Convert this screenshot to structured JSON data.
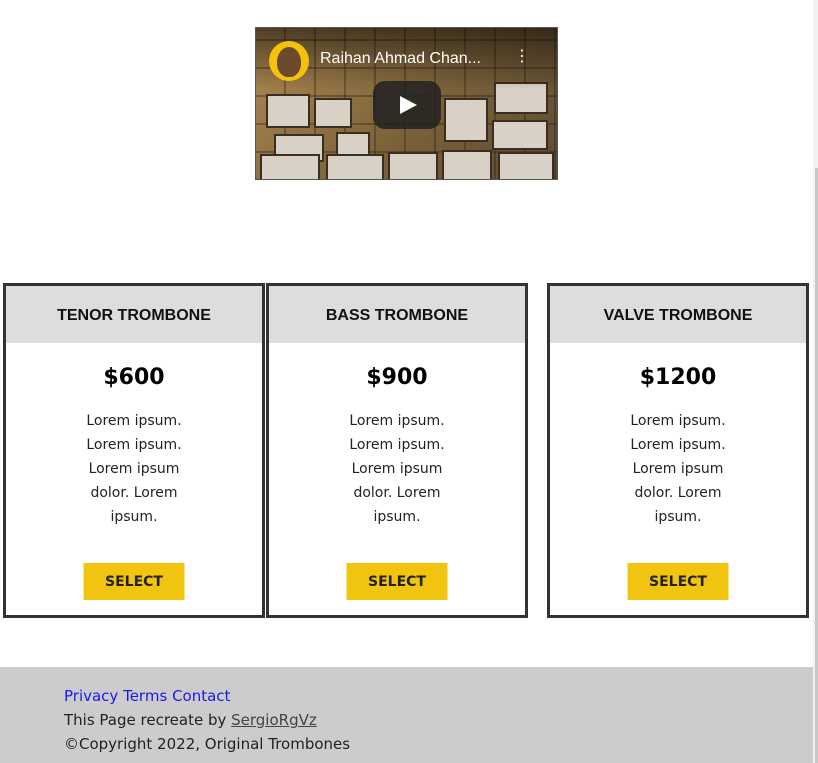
{
  "video": {
    "channel_title": "Raihan Ahmad Chan...",
    "menu_glyph": "⋮"
  },
  "plans": [
    {
      "name": "TENOR TROMBONE",
      "price": "$600",
      "description": "Lorem ipsum. Lorem ipsum. Lorem ipsum dolor. Lorem ipsum.",
      "button": "SELECT"
    },
    {
      "name": "BASS TROMBONE",
      "price": "$900",
      "description": "Lorem ipsum. Lorem ipsum. Lorem ipsum dolor. Lorem ipsum.",
      "button": "SELECT"
    },
    {
      "name": "VALVE TROMBONE",
      "price": "$1200",
      "description": "Lorem ipsum. Lorem ipsum. Lorem ipsum dolor. Lorem ipsum.",
      "button": "SELECT"
    }
  ],
  "footer": {
    "links": [
      "Privacy",
      "Terms",
      "Contact"
    ],
    "credit_prefix": "This Page recreate by ",
    "credit_author": "SergioRgVz",
    "copyright": "©Copyright 2022, Original Trombones"
  },
  "colors": {
    "button_bg": "#f1c40f",
    "card_header_bg": "#dddddd",
    "footer_bg": "#cccccc",
    "link": "#1a1aee"
  }
}
